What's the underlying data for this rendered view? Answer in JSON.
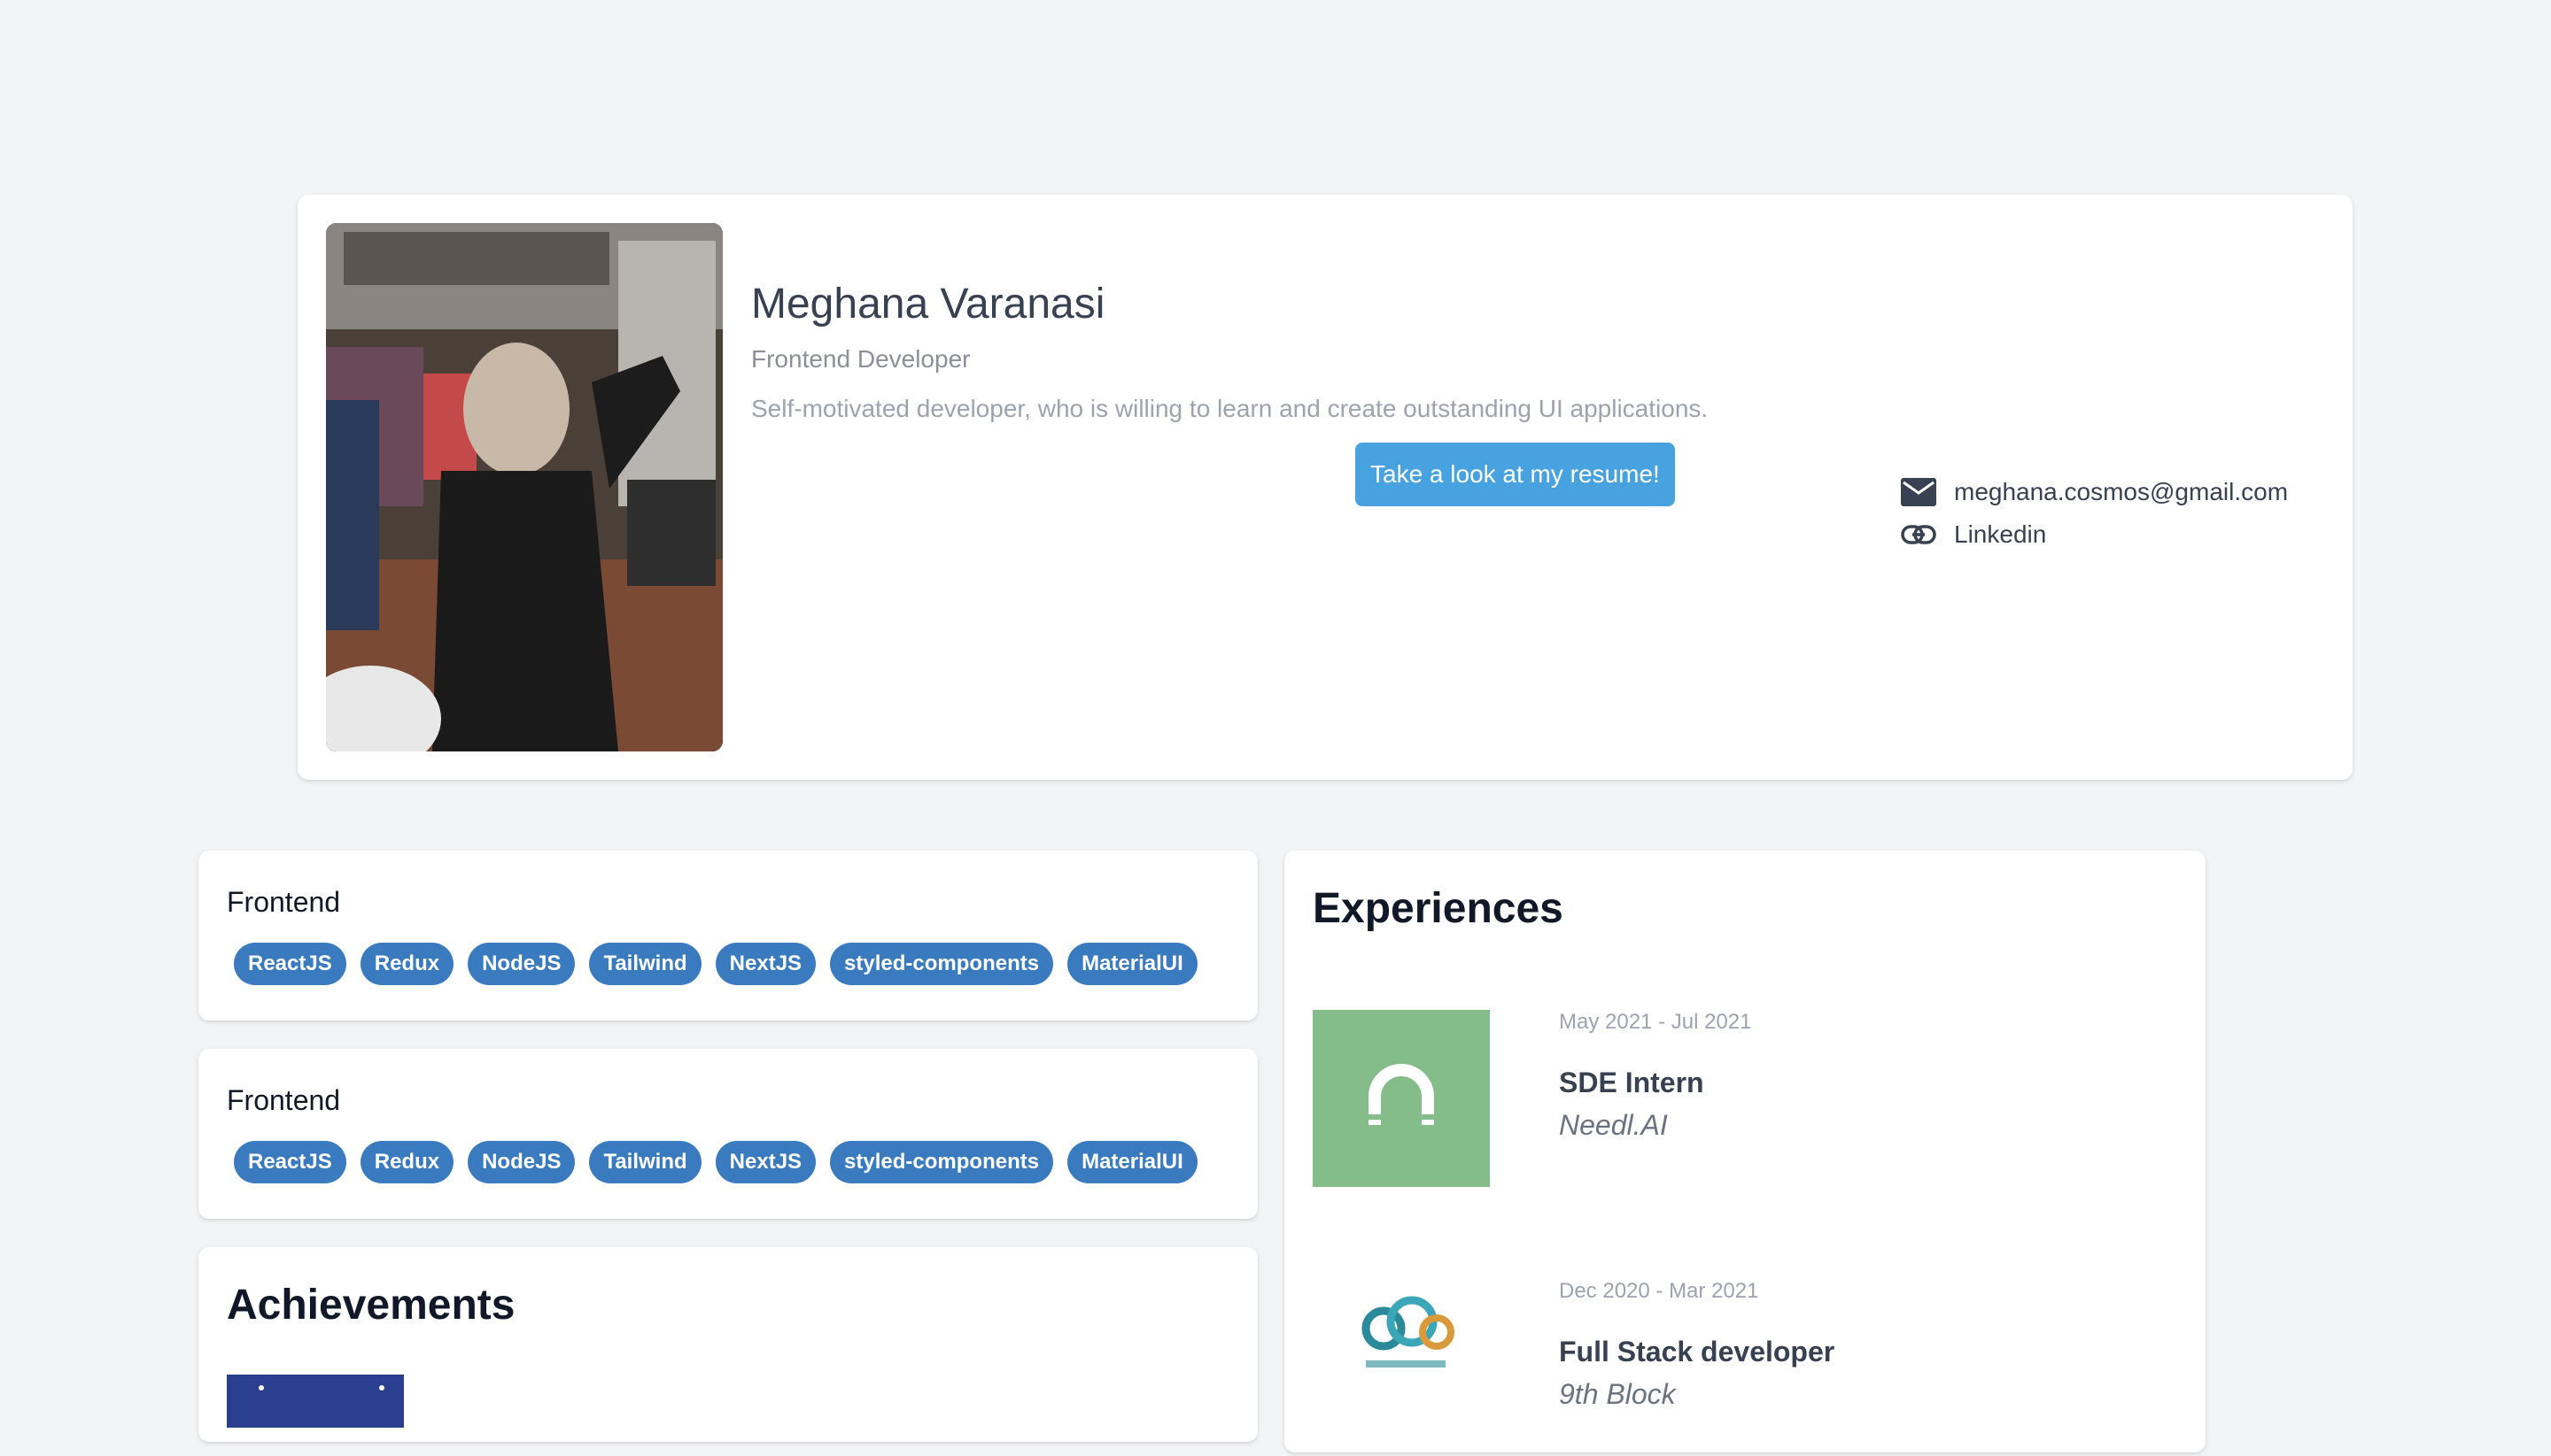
{
  "profile": {
    "name": "Meghana Varanasi",
    "role": "Frontend Developer",
    "bio": "Self-motivated developer, who is willing to learn and create outstanding UI applications.",
    "resume_button": "Take a look at my resume!",
    "photo_icon": "profile-photo",
    "contacts": [
      {
        "icon": "mail-icon",
        "label": "meghana.cosmos@gmail.com"
      },
      {
        "icon": "link-icon",
        "label": "Linkedin"
      }
    ]
  },
  "skills": [
    {
      "title": "Frontend",
      "tags": [
        "ReactJS",
        "Redux",
        "NodeJS",
        "Tailwind",
        "NextJS",
        "styled-components",
        "MaterialUI"
      ]
    },
    {
      "title": "Frontend",
      "tags": [
        "ReactJS",
        "Redux",
        "NodeJS",
        "Tailwind",
        "NextJS",
        "styled-components",
        "MaterialUI"
      ]
    }
  ],
  "achievements": {
    "title": "Achievements"
  },
  "experiences": {
    "title": "Experiences",
    "items": [
      {
        "dates": "May 2021 - Jul 2021",
        "title": "SDE Intern",
        "company": "Needl.AI",
        "logo": "needl-logo"
      },
      {
        "dates": "Dec 2020 - Mar 2021",
        "title": "Full Stack developer",
        "company": "9th Block",
        "logo": "9th-block-logo"
      }
    ]
  },
  "colors": {
    "background": "#f3f4f6",
    "card": "#ffffff",
    "primary_button": "#48a2e0",
    "tag": "#3a7bc0",
    "needl_logo_bg": "#84bd8a"
  }
}
